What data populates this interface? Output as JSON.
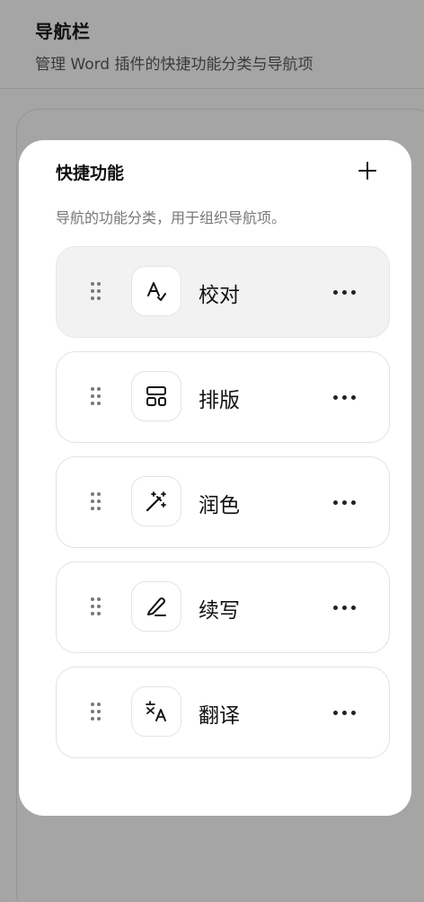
{
  "header": {
    "title": "导航栏",
    "subtitle": "管理 Word 插件的快捷功能分类与导航项"
  },
  "sheet": {
    "title": "快捷功能",
    "description": "导航的功能分类，用于组织导航项。",
    "items": [
      {
        "label": "校对",
        "icon": "proofread-icon",
        "active": true
      },
      {
        "label": "排版",
        "icon": "layout-icon",
        "active": false
      },
      {
        "label": "润色",
        "icon": "magic-wand-icon",
        "active": false
      },
      {
        "label": "续写",
        "icon": "pen-icon",
        "active": false
      },
      {
        "label": "翻译",
        "icon": "translate-icon",
        "active": false
      }
    ]
  },
  "colors": {
    "overlay": "#a5a5a5",
    "sheet": "#ffffff",
    "active_item": "#f2f2f2",
    "border": "#e2e2e2"
  }
}
